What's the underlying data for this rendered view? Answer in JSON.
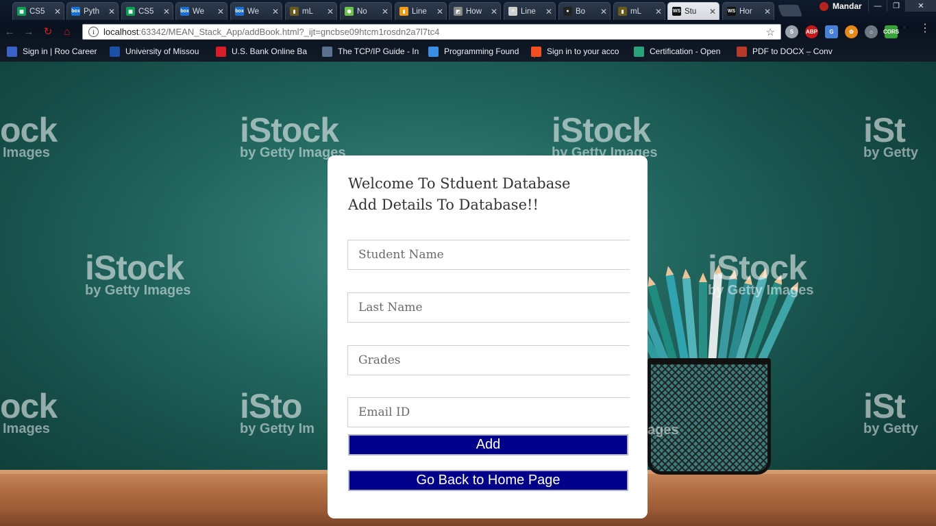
{
  "browser": {
    "tabs": [
      {
        "label": "CS5",
        "icon": "sheets-icon",
        "color": "#0f9d58",
        "active": false
      },
      {
        "label": "Pyth",
        "icon": "box-icon",
        "color": "#1a6fd1",
        "active": false
      },
      {
        "label": "CS5",
        "icon": "sheets-icon",
        "color": "#0f9d58",
        "active": false
      },
      {
        "label": "We",
        "icon": "box-icon",
        "color": "#1a6fd1",
        "active": false
      },
      {
        "label": "We",
        "icon": "box-icon",
        "color": "#1a6fd1",
        "active": false
      },
      {
        "label": "mL",
        "icon": "mlab-icon",
        "color": "#6b5a1e",
        "active": false
      },
      {
        "label": "No",
        "icon": "nodejs-icon",
        "color": "#6cc24a",
        "active": false
      },
      {
        "label": "Line",
        "icon": "bookmark-icon",
        "color": "#f09a1a",
        "active": false
      },
      {
        "label": "How",
        "icon": "page-icon",
        "color": "#888888",
        "active": false
      },
      {
        "label": "Line",
        "icon": "doc-icon",
        "color": "#cfcfcf",
        "active": false
      },
      {
        "label": "Bo",
        "icon": "github-icon",
        "color": "#222222",
        "active": false
      },
      {
        "label": "mL",
        "icon": "mlab-icon",
        "color": "#6b5a1e",
        "active": false
      },
      {
        "label": "Stu",
        "icon": "webstorm-icon",
        "color": "#111111",
        "active": true
      },
      {
        "label": "Hor",
        "icon": "webstorm-icon",
        "color": "#111111",
        "active": false
      }
    ],
    "profile_name": "Mandar",
    "url_host": "localhost",
    "url_path": ":63342/MEAN_Stack_App/addBook.html?_ijt=gncbse09htcm1rosdn2a7l7tc4",
    "bookmarks": [
      {
        "label": "Sign in | Roo Career",
        "icon": "doc-icon",
        "color": "#3b62c9"
      },
      {
        "label": "University of Missou",
        "icon": "umkc-icon",
        "color": "#1b4fa8"
      },
      {
        "label": "U.S. Bank Online Ba",
        "icon": "usbank-icon",
        "color": "#d71e28"
      },
      {
        "label": "The TCP/IP Guide - In",
        "icon": "network-icon",
        "color": "#5b6f8f"
      },
      {
        "label": "Programming Found",
        "icon": "coursera-icon",
        "color": "#3a8ee6"
      },
      {
        "label": "Sign in to your acco",
        "icon": "microsoft-icon",
        "color": "#f25022"
      },
      {
        "label": "Certification - Open",
        "icon": "oracle-icon",
        "color": "#2aa37a"
      },
      {
        "label": "PDF to DOCX – Conv",
        "icon": "pdf-icon",
        "color": "#b53a2a"
      }
    ]
  },
  "form": {
    "title_line1": "Welcome To Stduent Database",
    "title_line2": "Add Details To Database!!",
    "fields": [
      {
        "placeholder": "Student Name",
        "value": ""
      },
      {
        "placeholder": "Last Name",
        "value": ""
      },
      {
        "placeholder": "Grades",
        "value": ""
      },
      {
        "placeholder": "Email ID",
        "value": ""
      }
    ],
    "add_label": "Add",
    "back_label": "Go Back to Home Page"
  },
  "background": {
    "watermark_big": "iStock",
    "watermark_small": "by Getty Images",
    "watermark_small_right": "by Getty",
    "watermark_small_rest": "Images",
    "watermark_cropped_big": "ock",
    "watermark_cropped_big_right": "iSt",
    "watermark_mid_cut": "iSto",
    "watermark_mid_cut_small": "by Getty Im",
    "watermark_pencil_small": "ages"
  },
  "colors": {
    "button_bg": "#00008b",
    "chalkboard": "#22665f"
  }
}
